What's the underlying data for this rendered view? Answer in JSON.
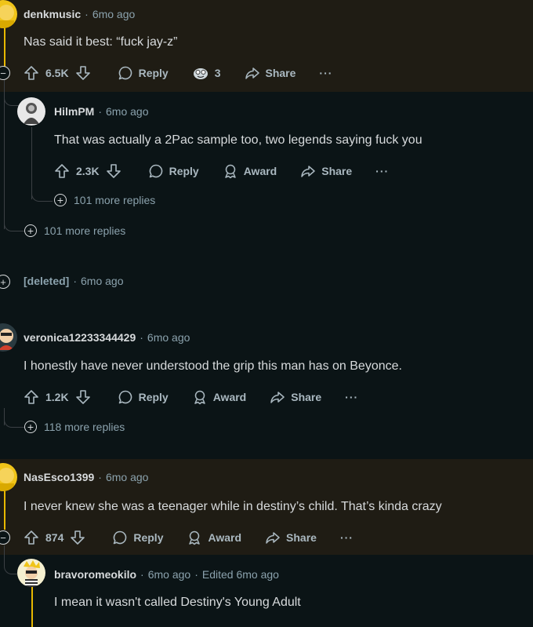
{
  "comments": [
    {
      "user": "denkmusic",
      "time": "6mo ago",
      "text": "Nas said it best: “fuck jay-z”",
      "votes": "6.5K",
      "reply": "Reply",
      "award_count": "3",
      "share": "Share",
      "more": "···"
    },
    {
      "user": "HilmPM",
      "time": "6mo ago",
      "text": "That was actually a 2Pac sample too, two legends saying fuck you",
      "votes": "2.3K",
      "reply": "Reply",
      "award": "Award",
      "share": "Share",
      "more": "···",
      "more_replies": "101 more replies"
    },
    {
      "more_replies": "101 more replies"
    },
    {
      "user": "[deleted]",
      "time": "6mo ago"
    },
    {
      "user": "veronica12233344429",
      "time": "6mo ago",
      "text": "I honestly have never understood the grip this man has on Beyonce.",
      "votes": "1.2K",
      "reply": "Reply",
      "award": "Award",
      "share": "Share",
      "more": "···",
      "more_replies": "118 more replies"
    },
    {
      "user": "NasEsco1399",
      "time": "6mo ago",
      "text": "I never knew she was a teenager while in destiny’s child. That’s kinda crazy",
      "votes": "874",
      "reply": "Reply",
      "award": "Award",
      "share": "Share",
      "more": "···"
    },
    {
      "user": "bravoromeokilo",
      "time": "6mo ago",
      "edited": "Edited 6mo ago",
      "text": "I mean it wasn't called Destiny's Young Adult"
    }
  ],
  "colors": {
    "background": "#0b1416",
    "highlight": "#1f1c14",
    "thread_accent": "#e8b800"
  }
}
